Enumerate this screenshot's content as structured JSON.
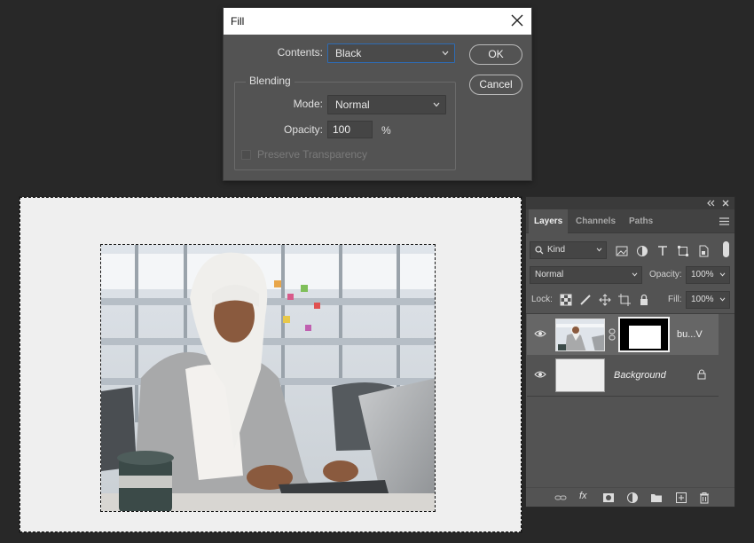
{
  "fill_dialog": {
    "title": "Fill",
    "contents_label": "Contents:",
    "contents_value": "Black",
    "ok_label": "OK",
    "cancel_label": "Cancel",
    "blending_title": "Blending",
    "mode_label": "Mode:",
    "mode_value": "Normal",
    "opacity_label": "Opacity:",
    "opacity_value": "100",
    "opacity_unit": "%",
    "preserve_label": "Preserve Transparency",
    "preserve_checked": false
  },
  "layers_panel": {
    "tabs": [
      {
        "label": "Layers",
        "active": true
      },
      {
        "label": "Channels",
        "active": false
      },
      {
        "label": "Paths",
        "active": false
      }
    ],
    "filter_kind": "Kind",
    "blend_mode": "Normal",
    "opacity_label": "Opacity:",
    "opacity_value": "100%",
    "lock_label": "Lock:",
    "fill_label": "Fill:",
    "fill_value": "100%",
    "layers": [
      {
        "name": "bu...V",
        "visible": true,
        "selected": true,
        "has_mask": true
      },
      {
        "name": "Background",
        "visible": true,
        "selected": false,
        "locked": true
      }
    ]
  },
  "icons": {
    "close": "close-icon",
    "visibility": "eye-icon",
    "lock": "lock-icon",
    "link": "link-icon"
  }
}
